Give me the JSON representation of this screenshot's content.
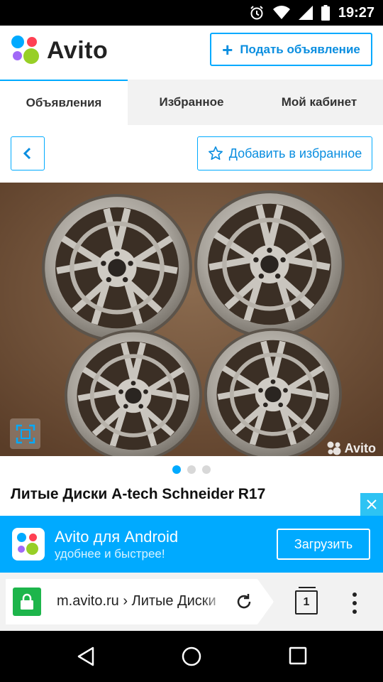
{
  "status_bar": {
    "time": "19:27",
    "icons": [
      "alarm-icon",
      "wifi-icon",
      "signal-icon",
      "battery-icon"
    ]
  },
  "header": {
    "logo_text": "Avito",
    "post_button": "Подать объявление",
    "brand_colors": {
      "blue": "#00aaff",
      "red": "#ff4053",
      "green": "#97cf26",
      "purple": "#a169f7",
      "blue_dot": "#0af"
    }
  },
  "tabs": [
    {
      "label": "Объявления",
      "active": true
    },
    {
      "label": "Избранное",
      "active": false
    },
    {
      "label": "Мой кабинет",
      "active": false
    }
  ],
  "actions": {
    "favorite_button": "Добавить в избранное"
  },
  "gallery": {
    "watermark": "Avito",
    "slide_index": 1,
    "slide_count": 3
  },
  "listing": {
    "title": "Литые Диски A-tech Schneider R17"
  },
  "app_banner": {
    "title": "Avito для Android",
    "subtitle": "удобнее и быстрее!",
    "button": "Загрузить"
  },
  "browser": {
    "url": "m.avito.ru › Литые Диски",
    "tab_count": "1"
  }
}
